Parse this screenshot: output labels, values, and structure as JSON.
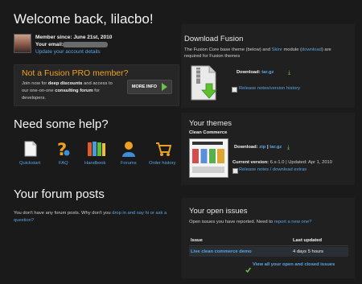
{
  "welcome": {
    "title": "Welcome back, lilacbo!",
    "member_since": "Member since: June 21st, 2010",
    "email_label": "Your email:",
    "update_link": "Update your account details"
  },
  "pro": {
    "title": "Not a Fusion PRO member?",
    "line1": "Join now for",
    "line1b": "deep discounts",
    "line1c": "and access to",
    "line2": "our one-on-one",
    "line2b": "consulting forum",
    "line2c": "for",
    "line3": "developers.",
    "button": "MORE INFO"
  },
  "download_fusion": {
    "title": "Download Fusion",
    "desc1": "The Fusion Core base theme (below) and",
    "skinr": "Skinr",
    "desc1b": "module (",
    "download_link": "download",
    "desc1c": ") are",
    "desc2": "required for Fusion themes",
    "download_label": "Download:",
    "tar": "tar.gz",
    "release_notes": "Release notes/version history"
  },
  "help": {
    "title": "Need some help?",
    "items": [
      {
        "label": "Quickstart",
        "icon": "document-icon"
      },
      {
        "label": "FAQ",
        "icon": "question-icon"
      },
      {
        "label": "Handbook",
        "icon": "books-icon"
      },
      {
        "label": "Forums",
        "icon": "user-icon"
      },
      {
        "label": "Order history",
        "icon": "cart-icon"
      }
    ]
  },
  "themes": {
    "title": "Your themes",
    "theme_name": "Clean Commerce",
    "download_label": "Download:",
    "zip": "zip",
    "sep": "|",
    "tar": "tar.gz",
    "current_version": "Current version:",
    "version": "6.x-1.0",
    "updated": "| Updated: Apr 1, 2010",
    "release_notes": "Release notes / download extras"
  },
  "forum": {
    "title": "Your forum posts",
    "text1": "You don't have any forum posts. Why don't you",
    "link1": "drop in and say hi or ask a",
    "link2": "question?"
  },
  "issues": {
    "title": "Your open issues",
    "desc": "Open issues you have reported. Need to",
    "report_link": "report a new one?",
    "col_issue": "Issue",
    "col_updated": "Last updated",
    "row_issue": "Live clean commerce demo",
    "row_updated": "4 days 5 hours",
    "view_all": "View all your open and closed issues"
  },
  "colors": {
    "link": "#5aa6e6",
    "accent_orange": "#f0a020",
    "accent_green": "#6cc04a"
  }
}
